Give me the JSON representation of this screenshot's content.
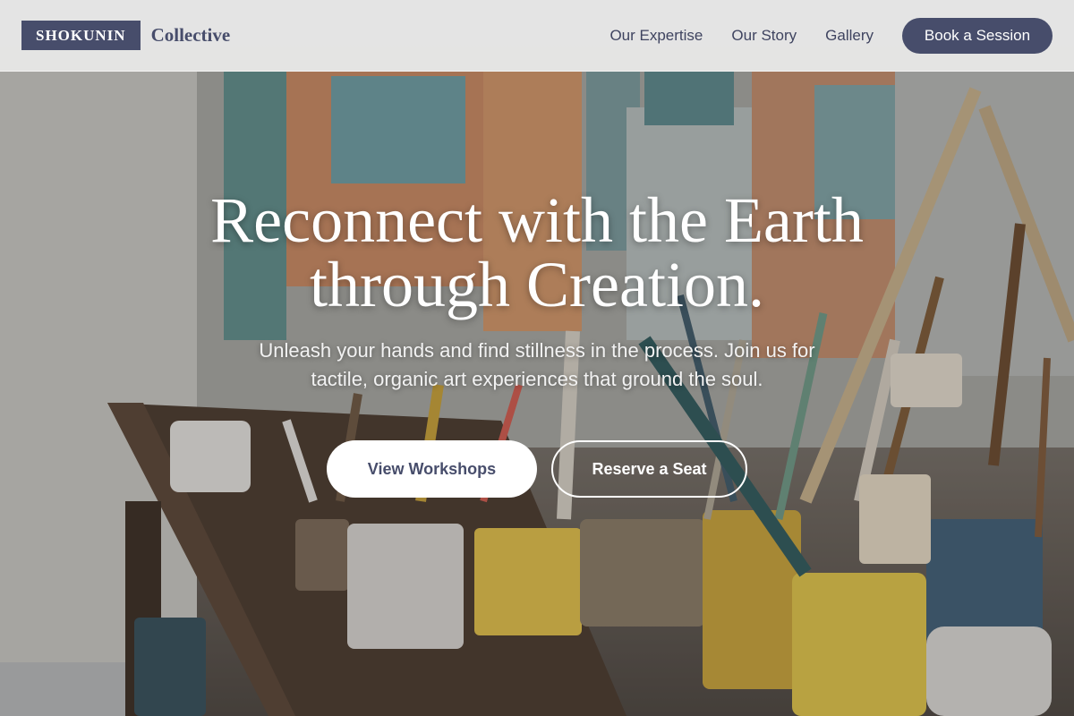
{
  "nav": {
    "brand_box": "SHOKUNIN",
    "brand_word": "Collective",
    "links": [
      "Our Expertise",
      "Our Story",
      "Gallery"
    ],
    "cta": "Book a Session"
  },
  "hero": {
    "title_line1": "Reconnect with the Earth",
    "title_line2": "through Creation.",
    "subtitle": "Unleash your hands and find stillness in the process. Join us for tactile, organic art experiences that ground the soul.",
    "primary_button": "View Workshops",
    "secondary_button": "Reserve a Seat",
    "background_image": "art-studio-paint-brushes-photo"
  },
  "colors": {
    "brand": "#474d6b",
    "nav_background": "#ececec",
    "hero_text": "#ffffff"
  }
}
